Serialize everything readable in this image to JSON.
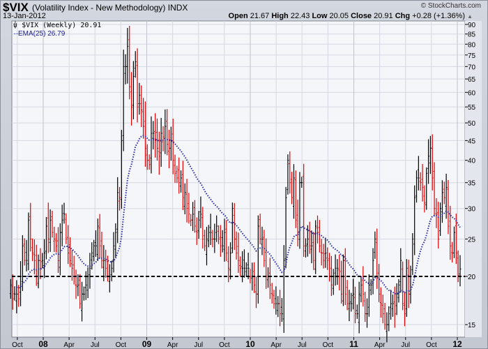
{
  "header": {
    "symbol": "$VIX",
    "name": "(Volatility Index - New Methodology) INDX",
    "date": "13-Jan-2012",
    "copyright": "© StockCharts.com",
    "open_label": "Open",
    "open": "21.67",
    "high_label": "High",
    "high": "22.43",
    "low_label": "Low",
    "low": "20.05",
    "close_label": "Close",
    "close": "20.91",
    "chg_label": "Chg",
    "chg": "+0.28 (+1.36%)",
    "chg_arrow": "▲"
  },
  "legend": {
    "series": "$VIX (Weekly) 20.91",
    "ema": "EMA(25) 26.79"
  },
  "colors": {
    "up": "#000000",
    "down": "#e00000",
    "ema": "#2a2aa0",
    "plot_bg": "#f4f6fa",
    "grid": "#d5d8e0"
  },
  "chart_data": {
    "type": "ohlc-bar",
    "title": "$VIX (Weekly)",
    "scale": "log",
    "ylim": [
      14,
      91
    ],
    "yticks": [
      15,
      20,
      25,
      30,
      35,
      40,
      45,
      50,
      55,
      60,
      65,
      70,
      75,
      80,
      85,
      90
    ],
    "reference_line": 20,
    "ema_period": 25,
    "xticks": [
      {
        "label": "Oct",
        "month": -3,
        "bold": false
      },
      {
        "label": "08",
        "month": 0,
        "bold": true
      },
      {
        "label": "Apr",
        "month": 3,
        "bold": false
      },
      {
        "label": "Jul",
        "month": 6,
        "bold": false
      },
      {
        "label": "Oct",
        "month": 9,
        "bold": false
      },
      {
        "label": "09",
        "month": 12,
        "bold": true
      },
      {
        "label": "Apr",
        "month": 15,
        "bold": false
      },
      {
        "label": "Jul",
        "month": 18,
        "bold": false
      },
      {
        "label": "Oct",
        "month": 21,
        "bold": false
      },
      {
        "label": "10",
        "month": 24,
        "bold": true
      },
      {
        "label": "Apr",
        "month": 27,
        "bold": false
      },
      {
        "label": "Jul",
        "month": 30,
        "bold": false
      },
      {
        "label": "Oct",
        "month": 33,
        "bold": false
      },
      {
        "label": "11",
        "month": 36,
        "bold": true
      },
      {
        "label": "Apr",
        "month": 39,
        "bold": false
      },
      {
        "label": "Jul",
        "month": 42,
        "bold": false
      },
      {
        "label": "Oct",
        "month": 45,
        "bold": false
      },
      {
        "label": "12",
        "month": 48,
        "bold": true
      }
    ],
    "closes": [
      19,
      17.5,
      18,
      18,
      17.5,
      20,
      24,
      22,
      22,
      28,
      25,
      23,
      22,
      20,
      22,
      21,
      22,
      23,
      27,
      25,
      28,
      26,
      25,
      24,
      22,
      26,
      28,
      29,
      25,
      23,
      22,
      21,
      20,
      19,
      19,
      17,
      18,
      18,
      19,
      20,
      21,
      23,
      24,
      24,
      27,
      24,
      22,
      22,
      21,
      20,
      20,
      21,
      24,
      26,
      33,
      32,
      45,
      70,
      70,
      79,
      62,
      55,
      66,
      72,
      55,
      59,
      54,
      49,
      43,
      40,
      39,
      47,
      47,
      45,
      43,
      41,
      47,
      46,
      49,
      44,
      43,
      45,
      40,
      37,
      36,
      35,
      36,
      32,
      33,
      30,
      29,
      28,
      29,
      27,
      26,
      28,
      29,
      25,
      24,
      25,
      26,
      26,
      25,
      25,
      27,
      25,
      24,
      24,
      26,
      23,
      21,
      23,
      30,
      25,
      23,
      22,
      21,
      21,
      21,
      21,
      21,
      20,
      20,
      19,
      18,
      27,
      25,
      25,
      22,
      20,
      20,
      19,
      18,
      17,
      17,
      17,
      16,
      16,
      22,
      32,
      40,
      35,
      32,
      36,
      28,
      26,
      35,
      35,
      24,
      24,
      25,
      24,
      24,
      22,
      27,
      26,
      24,
      23,
      22,
      23,
      22,
      20,
      19,
      20,
      21,
      21,
      20,
      18,
      22,
      18,
      17,
      17,
      17,
      18,
      16,
      16,
      18,
      19,
      18,
      16,
      16,
      19,
      19,
      22,
      25,
      20,
      18,
      17,
      16,
      15,
      15,
      16,
      17,
      17,
      16,
      18,
      19,
      22,
      17,
      16,
      21,
      18,
      20,
      25,
      32,
      36,
      36,
      35,
      34,
      31,
      37,
      41,
      43,
      36,
      30,
      29,
      25,
      30,
      33,
      32,
      34,
      27,
      24,
      23,
      26,
      23,
      20.1,
      20.91
    ]
  }
}
